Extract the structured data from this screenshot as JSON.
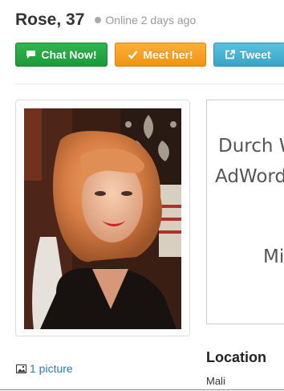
{
  "profile": {
    "name_age": "Rose, 37",
    "status": "Online 2 days ago"
  },
  "actions": {
    "chat_label": "Chat Now!",
    "meet_label": "Meet her!",
    "tweet_label": "Tweet"
  },
  "ad": {
    "line1": "Durch W",
    "line2": "AdWord",
    "line3": "Mit"
  },
  "pictures": {
    "link_label": "1 picture"
  },
  "location": {
    "title": "Location",
    "value": "Mali"
  },
  "colors": {
    "chat": "#22a843",
    "meet": "#f7a325",
    "tweet": "#49b3d4",
    "link": "#2a7ab0"
  },
  "icons": {
    "status": "status-dot-icon",
    "chat": "chat-bubble-icon",
    "meet": "checkmark-icon",
    "tweet": "share-icon",
    "pictures": "picture-icon"
  }
}
